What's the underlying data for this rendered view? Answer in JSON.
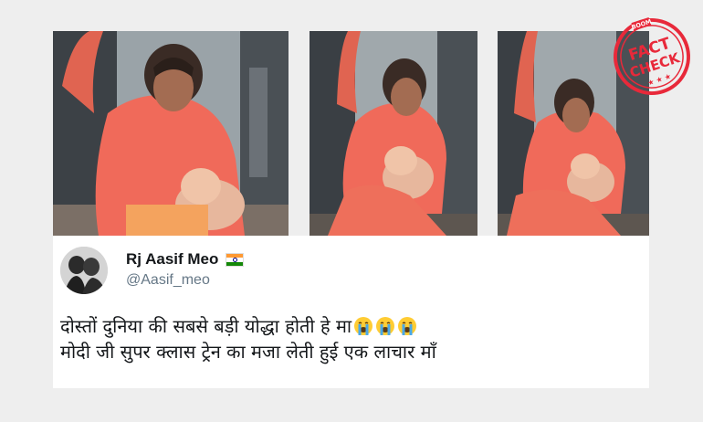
{
  "stamp": {
    "brand": "BOOM",
    "line1": "FACT",
    "line2": "CHECK",
    "stars": "★ ★ ★",
    "color": "#e8293a"
  },
  "frames": [
    {
      "name": "video-frame-1"
    },
    {
      "name": "video-frame-2"
    },
    {
      "name": "video-frame-3"
    }
  ],
  "tweet": {
    "display_name": "Rj Aasif Meo",
    "flag": "india-flag-icon",
    "handle": "@Aasif_meo",
    "line1": "दोस्तों दुनिया की सबसे बड़ी योद्धा होती हे मा",
    "line1_emoji": "loudly-crying-face-icon",
    "line1_emoji_count": 3,
    "line2": "मोदी जी सुपर क्लास ट्रेन का मजा लेती हुई एक लाचार माँ"
  },
  "colors": {
    "background": "#eeeeee",
    "card": "#ffffff",
    "handle": "#657786",
    "text": "#14171a",
    "flag_saffron": "#ff9933",
    "flag_white": "#ffffff",
    "flag_green": "#138808",
    "shirt": "#f06a5a"
  }
}
